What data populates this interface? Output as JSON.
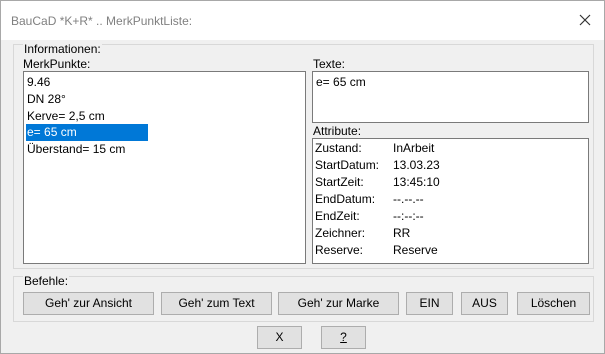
{
  "window": {
    "title": "BauCaD *K+R* .. MerkPunktListe:",
    "close_glyph": "✕"
  },
  "info": {
    "label": "Informationen:"
  },
  "merkpunkte": {
    "label": "MerkPunkte:",
    "items": [
      "9.46",
      "DN 28°",
      "Kerve= 2,5 cm",
      "e= 65 cm",
      "Überstand= 15 cm"
    ],
    "selected": "e= 65 cm"
  },
  "texte": {
    "label": "Texte:",
    "value": "e= 65 cm"
  },
  "attribute": {
    "label": "Attribute:",
    "rows": [
      {
        "key": "Zustand:",
        "value": "InArbeit"
      },
      {
        "key": "StartDatum:",
        "value": "13.03.23"
      },
      {
        "key": "StartZeit:",
        "value": "13:45:10"
      },
      {
        "key": "EndDatum:",
        "value": "--.--.--"
      },
      {
        "key": "EndZeit:",
        "value": "--:--:--"
      },
      {
        "key": "Zeichner:",
        "value": "RR"
      },
      {
        "key": "Reserve:",
        "value": "Reserve"
      }
    ]
  },
  "befehle": {
    "label": "Befehle:",
    "buttons": [
      "Geh' zur Ansicht",
      "Geh' zum Text",
      "Geh' zur Marke",
      "EIN",
      "AUS",
      "Löschen"
    ]
  },
  "footer": {
    "x_label": "X",
    "help_label": "?"
  },
  "colors": {
    "selection": "#0078d7",
    "title_text": "#808080",
    "dialog_bg": "#f0f0f0"
  }
}
